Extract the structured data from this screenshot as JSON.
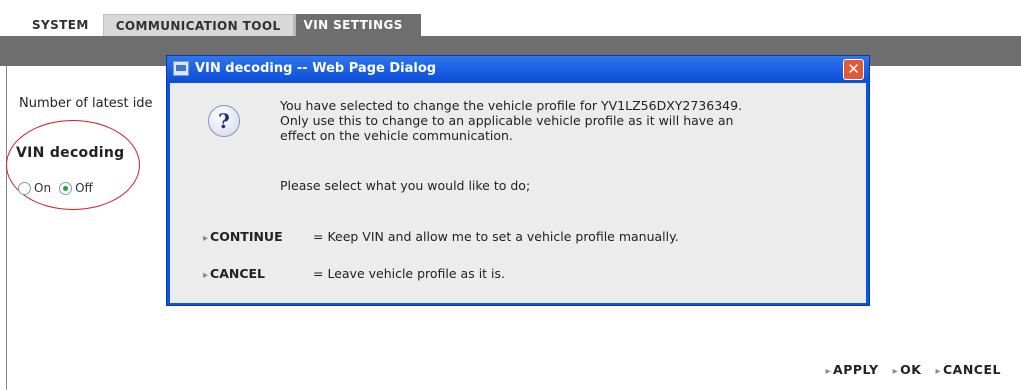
{
  "tabs": [
    {
      "label": "SYSTEM"
    },
    {
      "label": "COMMUNICATION TOOL"
    },
    {
      "label": "VIN SETTINGS",
      "active": true
    }
  ],
  "left_panel": {
    "latest_label": "Number of latest ide",
    "vin_decoding_title": "VIN decoding",
    "radio_on_label": "On",
    "radio_off_label": "Off",
    "selected": "Off"
  },
  "dialog": {
    "title": "VIN decoding -- Web Page Dialog",
    "close_symbol": "✕",
    "message_lines": [
      "You have selected to change the vehicle profile for YV1LZ56DXY2736349.",
      "Only use this to change to an applicable vehicle profile as it will have an",
      "effect on the vehicle communication."
    ],
    "prompt": "Please select what you would like to do;",
    "options": [
      {
        "label": "CONTINUE",
        "description": "= Keep VIN and allow me to set a vehicle profile manually."
      },
      {
        "label": "CANCEL",
        "description": "= Leave vehicle profile as it is."
      }
    ],
    "icon": "question-icon"
  },
  "buttons": {
    "apply": "APPLY",
    "ok": "OK",
    "cancel": "CANCEL"
  },
  "colors": {
    "tab_bar": "#6e6e6e",
    "dialog_frame": "#0b56de",
    "circle_annotation": "#c8202a"
  }
}
